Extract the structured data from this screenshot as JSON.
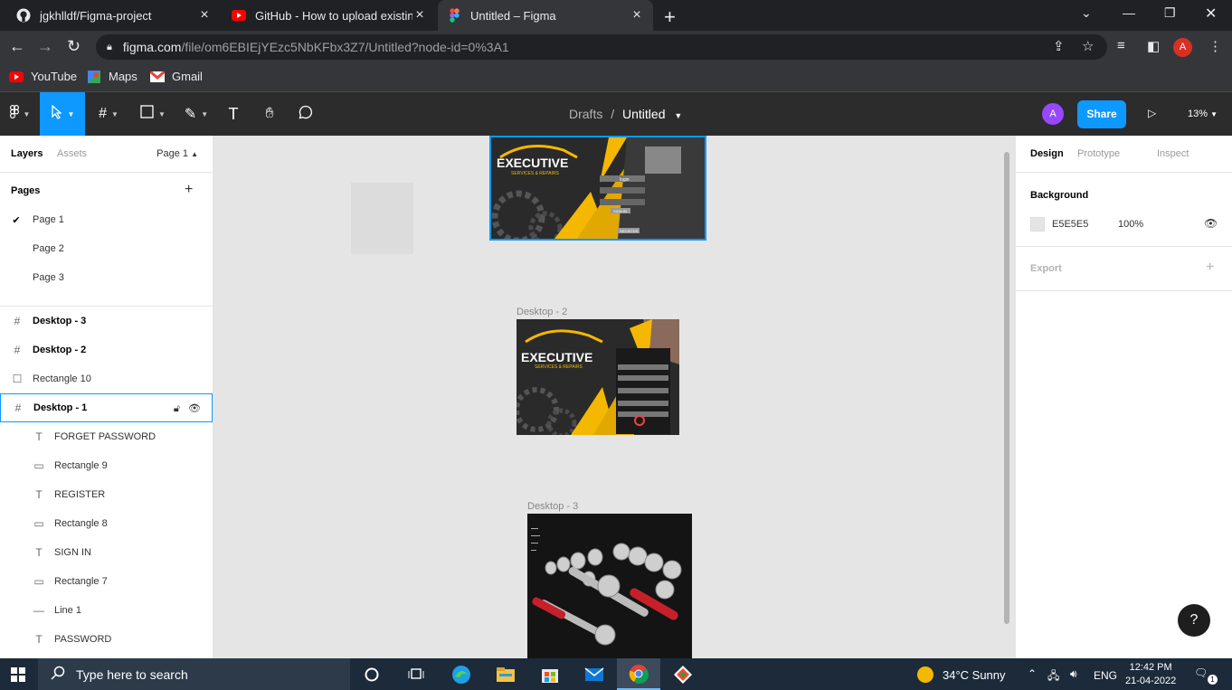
{
  "browser": {
    "tabs": [
      {
        "title": "jgkhlldf/Figma-project",
        "icon": "github-icon"
      },
      {
        "title": "GitHub - How to upload existing",
        "icon": "youtube-icon"
      },
      {
        "title": "Untitled – Figma",
        "icon": "figma-icon"
      }
    ],
    "url": {
      "host": "figma.com",
      "path": "/file/om6EBIEjYEzc5NbKFbx3Z7/Untitled?node-id=0%3A1"
    },
    "profile_initial": "A",
    "bookmarks": [
      {
        "label": "YouTube"
      },
      {
        "label": "Maps"
      },
      {
        "label": "Gmail"
      }
    ]
  },
  "figma": {
    "breadcrumb": {
      "parent": "Drafts",
      "separator": "/",
      "file": "Untitled"
    },
    "avatar_initial": "A",
    "share_label": "Share",
    "zoom": "13%"
  },
  "left_panel": {
    "tab_layers": "Layers",
    "tab_assets": "Assets",
    "current_page": "Page 1",
    "pages_header": "Pages",
    "pages": [
      "Page 1",
      "Page 2",
      "Page 3"
    ],
    "layers": [
      {
        "name": "Desktop - 3",
        "type": "frame"
      },
      {
        "name": "Desktop - 2",
        "type": "frame"
      },
      {
        "name": "Rectangle 10",
        "type": "rect"
      },
      {
        "name": "Desktop - 1",
        "type": "frame"
      },
      {
        "name": "FORGET PASSWORD",
        "type": "text"
      },
      {
        "name": "Rectangle 9",
        "type": "rect"
      },
      {
        "name": "REGISTER",
        "type": "text"
      },
      {
        "name": "Rectangle 8",
        "type": "rect"
      },
      {
        "name": "SIGN IN",
        "type": "text"
      },
      {
        "name": "Rectangle 7",
        "type": "rect"
      },
      {
        "name": "Line 1",
        "type": "line"
      },
      {
        "name": "PASSWORD",
        "type": "text"
      }
    ]
  },
  "canvas": {
    "frame_labels": [
      "Desktop - 2",
      "Desktop - 3"
    ],
    "brand_text": "EXECUTIVE",
    "brand_sub": "SERVICES & REPAIRS",
    "form_labels": [
      "login",
      "SIGN IN",
      "REGISTER"
    ]
  },
  "right_panel": {
    "tabs": [
      "Design",
      "Prototype",
      "Inspect"
    ],
    "background_title": "Background",
    "background_hex": "E5E5E5",
    "background_opacity": "100%",
    "export_label": "Export"
  },
  "taskbar": {
    "search_placeholder": "Type here to search",
    "weather": "34°C  Sunny",
    "language": "ENG",
    "time": "12:42 PM",
    "date": "21-04-2022",
    "notification_count": "1"
  }
}
